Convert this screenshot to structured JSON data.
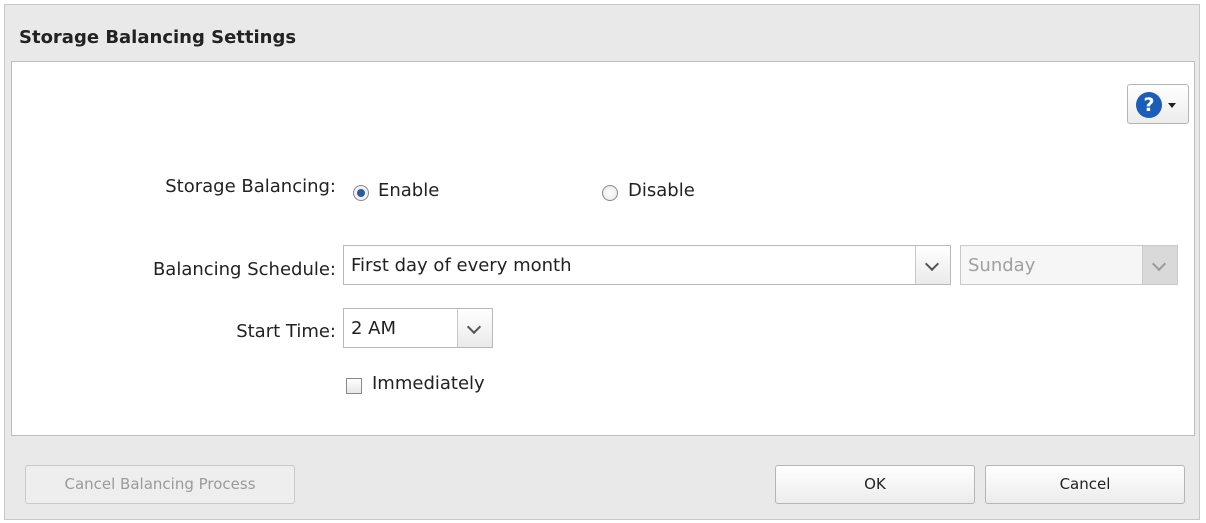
{
  "dialog": {
    "title": "Storage Balancing Settings"
  },
  "help": {
    "icon": "help-icon",
    "glyph": "?"
  },
  "form": {
    "storage_balancing": {
      "label": "Storage Balancing:",
      "options": [
        {
          "label": "Enable",
          "selected": true
        },
        {
          "label": "Disable",
          "selected": false
        }
      ]
    },
    "balancing_schedule": {
      "label": "Balancing Schedule:",
      "value": "First day of every month",
      "day_value": "Sunday",
      "day_disabled": true
    },
    "start_time": {
      "label": "Start Time:",
      "value": "2 AM"
    },
    "immediately": {
      "label": "Immediately",
      "checked": false
    }
  },
  "footer": {
    "cancel_process_label": "Cancel Balancing Process",
    "ok_label": "OK",
    "cancel_label": "Cancel"
  },
  "colors": {
    "accent": "#1b5db8",
    "radio_selected": "#2a5a9e"
  }
}
